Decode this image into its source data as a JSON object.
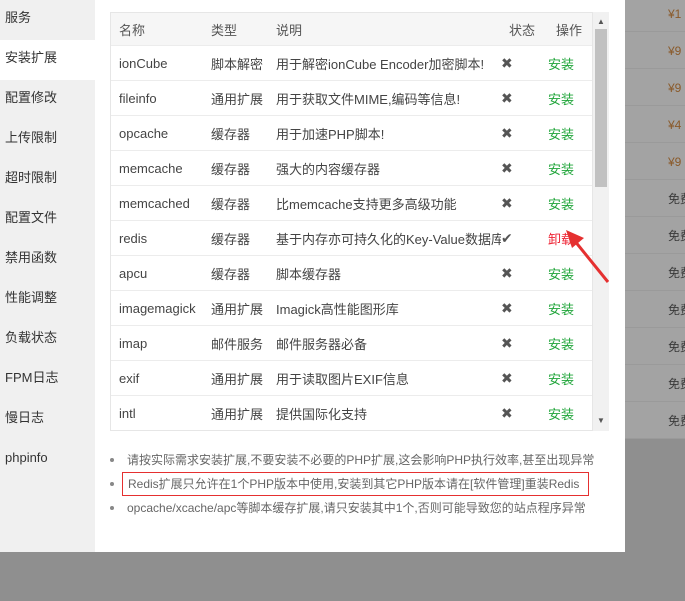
{
  "sidebar": {
    "items": [
      {
        "label": "服务",
        "active": false
      },
      {
        "label": "安装扩展",
        "active": true
      },
      {
        "label": "配置修改",
        "active": false
      },
      {
        "label": "上传限制",
        "active": false
      },
      {
        "label": "超时限制",
        "active": false
      },
      {
        "label": "配置文件",
        "active": false
      },
      {
        "label": "禁用函数",
        "active": false
      },
      {
        "label": "性能调整",
        "active": false
      },
      {
        "label": "负载状态",
        "active": false
      },
      {
        "label": "FPM日志",
        "active": false
      },
      {
        "label": "慢日志",
        "active": false
      },
      {
        "label": "phpinfo",
        "active": false
      }
    ]
  },
  "table": {
    "headers": {
      "name": "名称",
      "type": "类型",
      "desc": "说明",
      "status": "状态",
      "action": "操作"
    },
    "rows": [
      {
        "name": "ionCube",
        "type": "脚本解密",
        "desc": "用于解密ionCube Encoder加密脚本!",
        "status": "✖",
        "action": "安装"
      },
      {
        "name": "fileinfo",
        "type": "通用扩展",
        "desc": "用于获取文件MIME,编码等信息!",
        "status": "✖",
        "action": "安装"
      },
      {
        "name": "opcache",
        "type": "缓存器",
        "desc": "用于加速PHP脚本!",
        "status": "✖",
        "action": "安装"
      },
      {
        "name": "memcache",
        "type": "缓存器",
        "desc": "强大的内容缓存器",
        "status": "✖",
        "action": "安装"
      },
      {
        "name": "memcached",
        "type": "缓存器",
        "desc": "比memcache支持更多高级功能",
        "status": "✖",
        "action": "安装"
      },
      {
        "name": "redis",
        "type": "缓存器",
        "desc": "基于内存亦可持久化的Key-Value数据库",
        "status": "✔",
        "action": "卸载"
      },
      {
        "name": "apcu",
        "type": "缓存器",
        "desc": "脚本缓存器",
        "status": "✖",
        "action": "安装"
      },
      {
        "name": "imagemagick",
        "type": "通用扩展",
        "desc": "Imagick高性能图形库",
        "status": "✖",
        "action": "安装"
      },
      {
        "name": "imap",
        "type": "邮件服务",
        "desc": "邮件服务器必备",
        "status": "✖",
        "action": "安装"
      },
      {
        "name": "exif",
        "type": "通用扩展",
        "desc": "用于读取图片EXIF信息",
        "status": "✖",
        "action": "安装"
      },
      {
        "name": "intl",
        "type": "通用扩展",
        "desc": "提供国际化支持",
        "status": "✖",
        "action": "安装"
      }
    ]
  },
  "tips": [
    "请按实际需求安装扩展,不要安装不必要的PHP扩展,这会影响PHP执行效率,甚至出现异常",
    "Redis扩展只允许在1个PHP版本中使用,安装到其它PHP版本请在[软件管理]重装Redis",
    "opcache/xcache/apc等脚本缓存扩展,请只安装其中1个,否则可能导致您的站点程序异常"
  ],
  "background": {
    "cells": [
      "¥1",
      "¥9",
      "¥9",
      "¥4",
      "¥9",
      "免费",
      "免费",
      "免费",
      "免费",
      "免费",
      "免费",
      "免费"
    ]
  },
  "colors": {
    "install": "#20a53a",
    "uninstall": "#e22233",
    "highlight_border": "#e53030",
    "arrow": "#e53030"
  }
}
